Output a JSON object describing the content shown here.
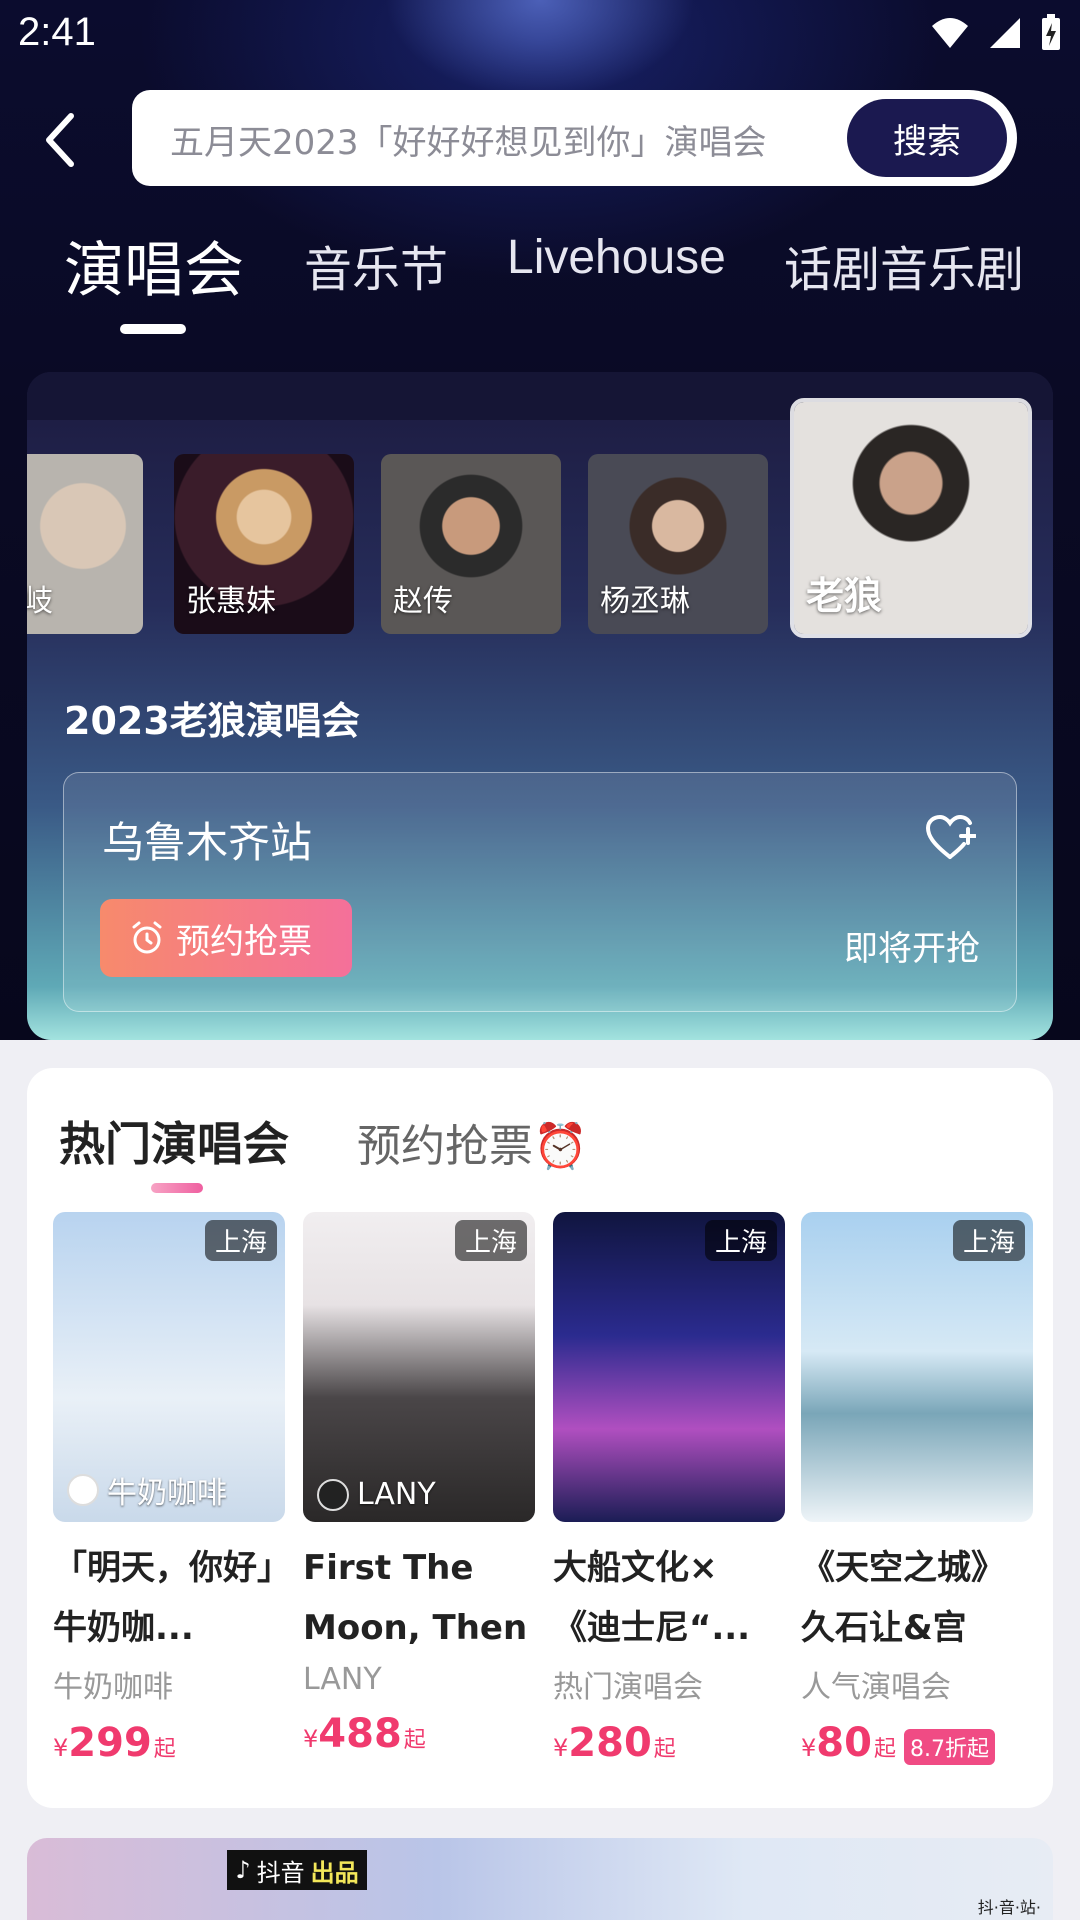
{
  "status_bar": {
    "time": "2:41"
  },
  "search": {
    "placeholder": "五月天2023「好好好想见到你」演唱会",
    "button_label": "搜索"
  },
  "tabs": [
    {
      "label": "演唱会",
      "active": true
    },
    {
      "label": "音乐节"
    },
    {
      "label": "Livehouse"
    },
    {
      "label": "话剧音乐剧"
    }
  ],
  "artists": [
    {
      "name": "敏岐"
    },
    {
      "name": "张惠妹"
    },
    {
      "name": "赵传"
    },
    {
      "name": "杨丞琳"
    },
    {
      "name": "老狼",
      "selected": true
    }
  ],
  "featured": {
    "title": "2023老狼演唱会",
    "station": "乌鲁木齐站",
    "remind_label": "预约抢票",
    "status": "即将开抢"
  },
  "hot": {
    "tabs": [
      {
        "label": "热门演唱会",
        "active": true
      },
      {
        "label": "预约抢票⏰"
      }
    ],
    "items": [
      {
        "city": "上海",
        "poster_tag": "牛奶咖啡",
        "title": "「明天，你好」牛奶咖...",
        "subtitle": "牛奶咖啡",
        "currency": "¥",
        "price": "299",
        "suffix": "起",
        "discount": ""
      },
      {
        "city": "上海",
        "poster_tag": "LANY",
        "title": "First The Moon, Then ...",
        "subtitle": "LANY",
        "currency": "¥",
        "price": "488",
        "suffix": "起",
        "discount": ""
      },
      {
        "city": "上海",
        "poster_tag": "",
        "title": "大船文化×《迪士尼“...",
        "subtitle": "热门演唱会",
        "currency": "¥",
        "price": "280",
        "suffix": "起",
        "discount": ""
      },
      {
        "city": "上海",
        "poster_tag": "",
        "title": "《天空之城》久石让&宫崎...",
        "subtitle": "人气演唱会",
        "currency": "¥",
        "price": "80",
        "suffix": "起",
        "discount": "8.7折起"
      }
    ]
  },
  "banner": {
    "brand": "抖音",
    "brand_tag": "出品",
    "site": "抖·音·站·"
  },
  "colors": {
    "accent": "#f03a6e",
    "search_button": "#1b1950"
  }
}
